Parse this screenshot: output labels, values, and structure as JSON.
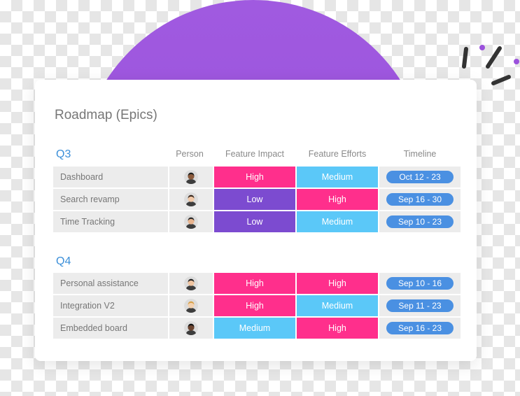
{
  "colors": {
    "high": "#ff2f8c",
    "medium": "#5bc8f8",
    "low": "#7c4bd0",
    "timeline": "#4a90e2"
  },
  "roadmap": {
    "title": "Roadmap (Epics)",
    "columns": {
      "person": "Person",
      "impact": "Feature Impact",
      "efforts": "Feature Efforts",
      "timeline": "Timeline"
    },
    "groups": [
      {
        "label": "Q3",
        "rows": [
          {
            "name": "Dashboard",
            "avatar": "person-avatar-icon",
            "impact": "High",
            "effort": "Medium",
            "timeline": "Oct 12 - 23"
          },
          {
            "name": "Search revamp",
            "avatar": "person-avatar-icon",
            "impact": "Low",
            "effort": "High",
            "timeline": "Sep 16 - 30"
          },
          {
            "name": "Time Tracking",
            "avatar": "person-avatar-icon",
            "impact": "Low",
            "effort": "Medium",
            "timeline": "Sep 10 - 23"
          }
        ]
      },
      {
        "label": "Q4",
        "rows": [
          {
            "name": "Personal assistance",
            "avatar": "person-avatar-icon",
            "impact": "High",
            "effort": "High",
            "timeline": "Sep 10 - 16"
          },
          {
            "name": "Integration V2",
            "avatar": "person-avatar-icon",
            "impact": "High",
            "effort": "Medium",
            "timeline": "Sep 11 - 23"
          },
          {
            "name": "Embedded board",
            "avatar": "person-avatar-icon",
            "impact": "Medium",
            "effort": "High",
            "timeline": "Sep 16 - 23"
          }
        ]
      }
    ]
  }
}
